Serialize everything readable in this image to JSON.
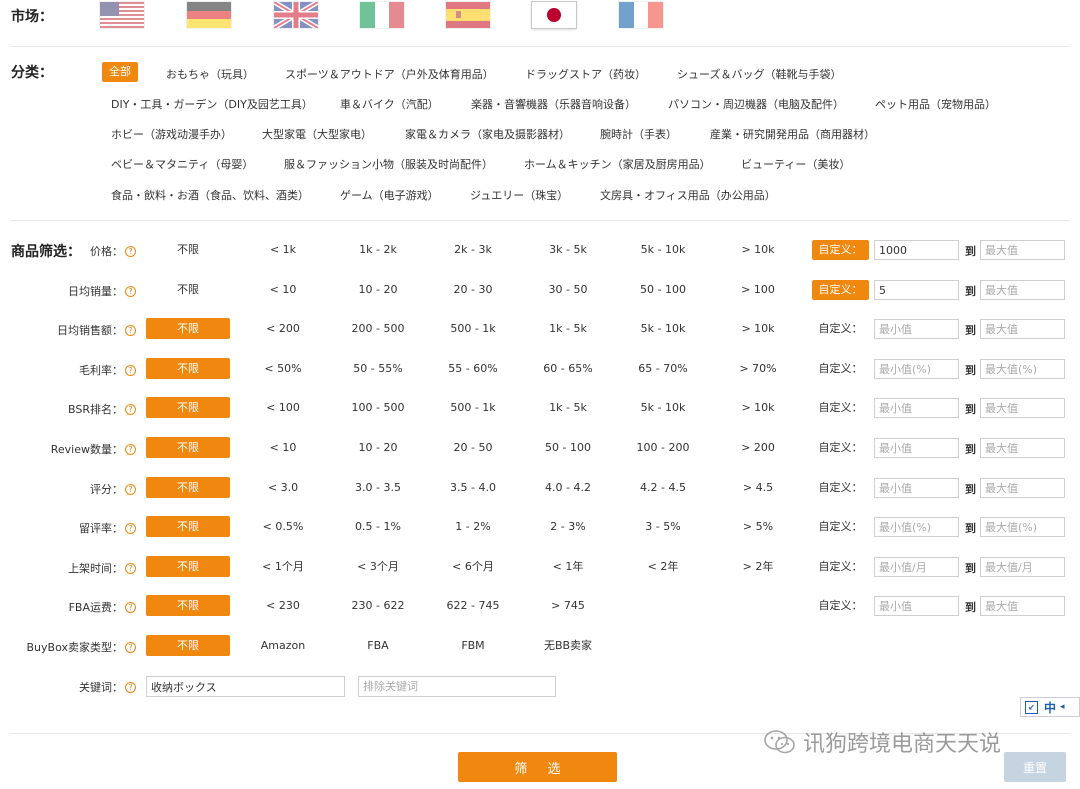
{
  "market": {
    "label": "市场：",
    "flags": [
      {
        "name": "us",
        "active": false
      },
      {
        "name": "de",
        "active": false
      },
      {
        "name": "uk",
        "active": false
      },
      {
        "name": "it",
        "active": false
      },
      {
        "name": "es",
        "active": false
      },
      {
        "name": "jp",
        "active": true
      },
      {
        "name": "fr",
        "active": false
      }
    ]
  },
  "category": {
    "label": "分类：",
    "active": "全部",
    "rows": [
      [
        "おもちゃ（玩具）",
        "スポーツ＆アウトドア（户外及体育用品）",
        "ドラッグストア（药妆）",
        "シューズ＆バッグ（鞋靴与手袋）"
      ],
      [
        "DIY・工具・ガーデン（DIY及园艺工具）",
        "車＆バイク（汽配）",
        "楽器・音響機器（乐器音响设备）",
        "パソコン・周辺機器（电脑及配件）",
        "ペット用品（宠物用品）"
      ],
      [
        "ホビー（游戏动漫手办）",
        "大型家電（大型家电）",
        "家電＆カメラ（家电及摄影器材）",
        "腕時計（手表）",
        "産業・研究開発用品（商用器材）"
      ],
      [
        "ベビー＆マタニティ（母婴）",
        "服＆ファッション小物（服装及时尚配件）",
        "ホーム＆キッチン（家居及厨房用品）",
        "ビューティー（美妆）"
      ],
      [
        "食品・飲料・お酒（食品、饮料、酒类）",
        "ゲーム（电子游戏）",
        "ジュエリー（珠宝）",
        "文房具・オフィス用品（办公用品）"
      ]
    ]
  },
  "filters": {
    "title": "商品筛选：",
    "custom_label": "自定义：",
    "to_label": "到",
    "rows": [
      {
        "label": "价格：",
        "options": [
          "不限",
          "< 1k",
          "1k - 2k",
          "2k - 3k",
          "3k - 5k",
          "5k - 10k",
          "> 10k"
        ],
        "selected": -1,
        "custom_selected": true,
        "min_value": "1000",
        "min_placeholder": "",
        "max_placeholder": "最大值"
      },
      {
        "label": "日均销量：",
        "options": [
          "不限",
          "< 10",
          "10 - 20",
          "20 - 30",
          "30 - 50",
          "50 - 100",
          "> 100"
        ],
        "selected": -1,
        "custom_selected": true,
        "min_value": "5",
        "min_placeholder": "",
        "max_placeholder": "最大值"
      },
      {
        "label": "日均销售额：",
        "options": [
          "不限",
          "< 200",
          "200 - 500",
          "500 - 1k",
          "1k - 5k",
          "5k - 10k",
          "> 10k"
        ],
        "selected": 0,
        "custom_selected": false,
        "min_value": "",
        "min_placeholder": "最小值",
        "max_placeholder": "最大值"
      },
      {
        "label": "毛利率：",
        "options": [
          "不限",
          "< 50%",
          "50 - 55%",
          "55 - 60%",
          "60 - 65%",
          "65 - 70%",
          "> 70%"
        ],
        "selected": 0,
        "custom_selected": false,
        "min_value": "",
        "min_placeholder": "最小值(%)",
        "max_placeholder": "最大值(%)"
      },
      {
        "label": "BSR排名：",
        "options": [
          "不限",
          "< 100",
          "100 - 500",
          "500 - 1k",
          "1k - 5k",
          "5k - 10k",
          "> 10k"
        ],
        "selected": 0,
        "custom_selected": false,
        "min_value": "",
        "min_placeholder": "最小值",
        "max_placeholder": "最大值"
      },
      {
        "label": "Review数量：",
        "options": [
          "不限",
          "< 10",
          "10 - 20",
          "20 - 50",
          "50 - 100",
          "100 - 200",
          "> 200"
        ],
        "selected": 0,
        "custom_selected": false,
        "min_value": "",
        "min_placeholder": "最小值",
        "max_placeholder": "最大值"
      },
      {
        "label": "评分：",
        "options": [
          "不限",
          "< 3.0",
          "3.0 - 3.5",
          "3.5 - 4.0",
          "4.0 - 4.2",
          "4.2 - 4.5",
          "> 4.5"
        ],
        "selected": 0,
        "custom_selected": false,
        "min_value": "",
        "min_placeholder": "最小值",
        "max_placeholder": "最大值"
      },
      {
        "label": "留评率：",
        "options": [
          "不限",
          "< 0.5%",
          "0.5 - 1%",
          "1 - 2%",
          "2 - 3%",
          "3 - 5%",
          "> 5%"
        ],
        "selected": 0,
        "custom_selected": false,
        "min_value": "",
        "min_placeholder": "最小值(%)",
        "max_placeholder": "最大值(%)"
      },
      {
        "label": "上架时间：",
        "options": [
          "不限",
          "< 1个月",
          "< 3个月",
          "< 6个月",
          "< 1年",
          "< 2年",
          "> 2年"
        ],
        "selected": 0,
        "custom_selected": false,
        "min_value": "",
        "min_placeholder": "最小值/月",
        "max_placeholder": "最大值/月"
      },
      {
        "label": "FBA运费：",
        "options": [
          "不限",
          "< 230",
          "230 - 622",
          "622 - 745",
          "> 745"
        ],
        "selected": 0,
        "custom_selected": false,
        "min_value": "",
        "min_placeholder": "最小值",
        "max_placeholder": "最大值"
      },
      {
        "label": "BuyBox卖家类型：",
        "options": [
          "不限",
          "Amazon",
          "FBA",
          "FBM",
          "无BB卖家"
        ],
        "selected": 0,
        "no_custom": true
      }
    ],
    "keyword": {
      "label": "关键词：",
      "include_value": "收纳ボックス",
      "exclude_placeholder": "排除关键词"
    }
  },
  "actions": {
    "filter": "筛 选",
    "reset": "重置"
  },
  "ime": {
    "label": "中"
  },
  "watermark": {
    "text": "讯狗跨境电商天天说"
  }
}
